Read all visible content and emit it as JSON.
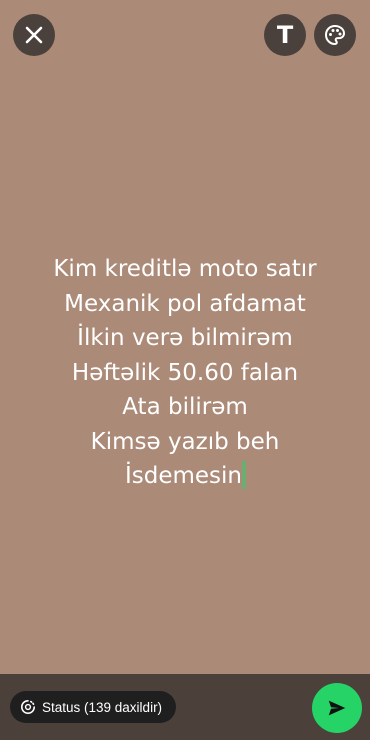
{
  "composer": {
    "background_color": "#ab8a78",
    "lines": [
      "Kim kreditlə moto satır",
      "Mexanik pol afdamat",
      "İlkin verə bilmirəm",
      "Həftəlik 50.60 falan",
      "Ata bilirəm",
      "Kimsə yazıb beh",
      "İsdemesin"
    ],
    "caret_color": "#25d366"
  },
  "toolbar": {
    "close_icon": "close-icon",
    "text_icon": "text-t-icon",
    "text_label": "T",
    "palette_icon": "palette-icon"
  },
  "bottom_bar": {
    "status_label": "Status (139 daxildir)",
    "status_icon": "status-ring-icon",
    "send_icon": "send-arrow-icon",
    "accent_color": "#25d366"
  }
}
